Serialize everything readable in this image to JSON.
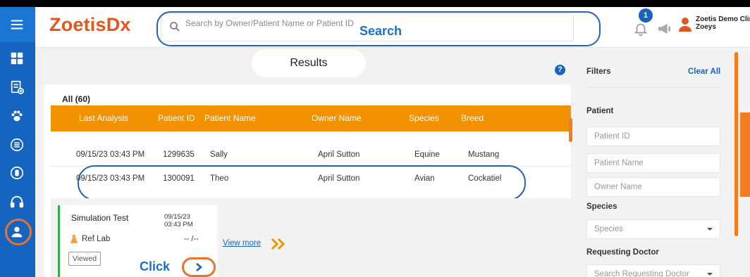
{
  "header": {
    "logo": "ZoetisDx",
    "search_placeholder": "Search by Owner/Patient Name or Patient ID",
    "notification_count": "1",
    "clinic_name": "Zoetis Demo Clini",
    "user_name": "Zoeys"
  },
  "annotations": {
    "search": "Search",
    "click": "Click"
  },
  "sidebar": {
    "items": [
      {
        "icon": "menu-icon"
      },
      {
        "icon": "dashboard-icon"
      },
      {
        "icon": "add-report-icon"
      },
      {
        "icon": "paw-icon"
      },
      {
        "icon": "list-icon"
      },
      {
        "icon": "info-icon"
      },
      {
        "icon": "headset-icon"
      },
      {
        "icon": "user-icon",
        "active": true
      }
    ]
  },
  "main": {
    "title": "Results",
    "help": "?",
    "all_count": "All (60)",
    "columns": [
      "Last Analysis",
      "Patient ID",
      "Patient Name",
      "Owner Name",
      "Species",
      "Breed"
    ],
    "rows": [
      [
        "09/15/23 03:43 PM",
        "1299635",
        "Sally",
        "April Sutton",
        "Equine",
        "Mustang"
      ],
      [
        "09/15/23 03:43 PM",
        "1300091",
        "Theo",
        "April Sutton",
        "Avian",
        "Cockatiel"
      ]
    ],
    "detail": {
      "test_name": "Simulation Test",
      "date": "09/15/23",
      "time": "03:43 PM",
      "lab": "Ref Lab",
      "lab_value": "-- /--",
      "status": "Viewed",
      "view_more": "View more",
      "next": "›"
    }
  },
  "filters": {
    "title": "Filters",
    "clear_all": "Clear All",
    "patient_label": "Patient",
    "patient_id_placeholder": "Patient ID",
    "patient_name_placeholder": "Patient Name",
    "owner_name_placeholder": "Owner Name",
    "species_label": "Species",
    "species_value": "Species",
    "doctor_label": "Requesting Doctor",
    "doctor_value": "Search Requesting Doctor"
  },
  "colors": {
    "brand_orange": "#f39200",
    "brand_blue": "#1565c0",
    "accent_green": "#2fae4a"
  }
}
